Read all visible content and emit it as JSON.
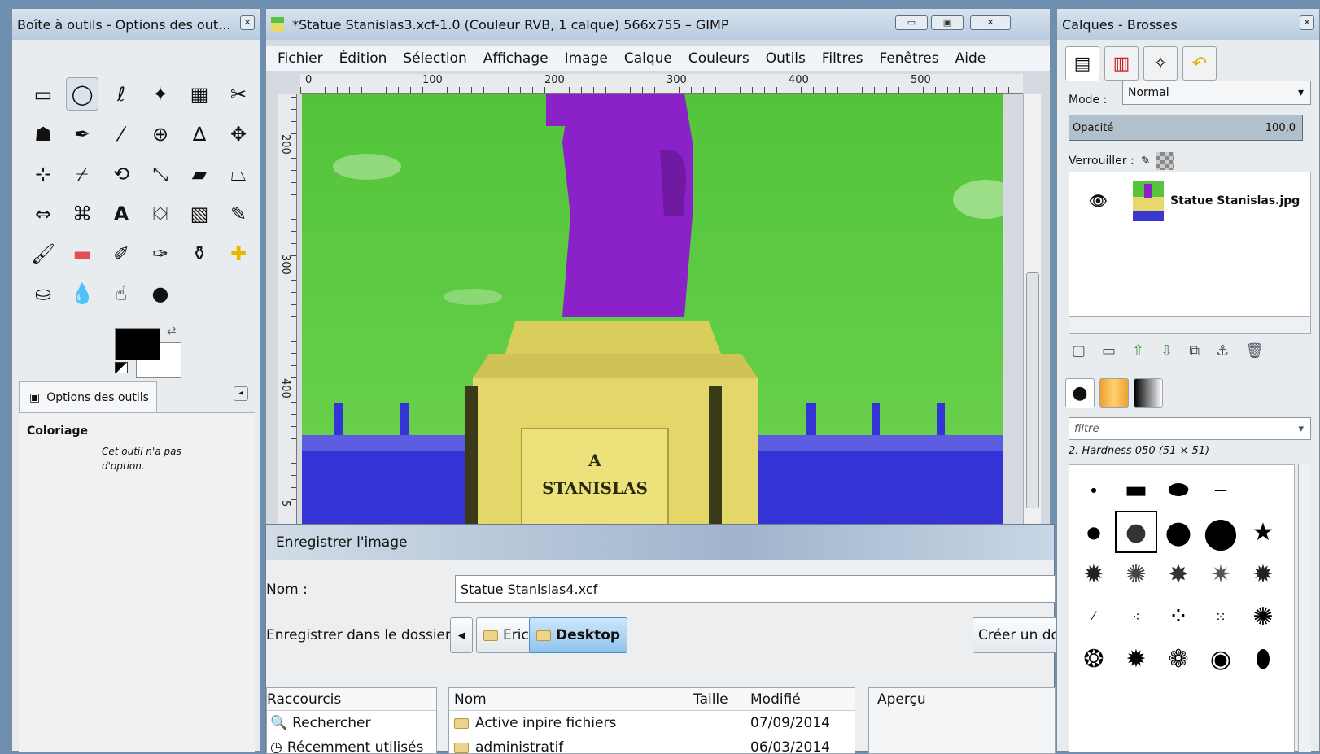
{
  "toolbox": {
    "title": "Boîte à outils - Options des out...",
    "tools": [
      "rect-select",
      "ellipse-select",
      "free-select",
      "fuzzy-select",
      "color-select",
      "scissors",
      "foreground-select",
      "paths",
      "color-picker",
      "zoom",
      "measure",
      "move",
      "align",
      "crop",
      "rotate",
      "scale",
      "shear",
      "perspective",
      "flip",
      "cage",
      "text",
      "bucket-fill",
      "blend",
      "pencil",
      "paintbrush",
      "eraser",
      "airbrush",
      "ink",
      "clone",
      "heal",
      "perspective-clone",
      "blur",
      "smudge",
      "dodge-burn"
    ],
    "options_tab": "Options des outils",
    "tool_name": "Coloriage",
    "tool_note": "Cet outil n'a pas d'option."
  },
  "image_window": {
    "title": "*Statue Stanislas3.xcf-1.0 (Couleur RVB, 1 calque) 566x755 – GIMP",
    "menu": [
      "Fichier",
      "Édition",
      "Sélection",
      "Affichage",
      "Image",
      "Calque",
      "Couleurs",
      "Outils",
      "Filtres",
      "Fenêtres",
      "Aide"
    ],
    "ruler_h": [
      "0",
      "100",
      "200",
      "300",
      "400",
      "500"
    ],
    "ruler_v": [
      "200",
      "300",
      "400",
      "5"
    ],
    "plaque_line1": "A",
    "plaque_line2": "STANISLAS",
    "colors": {
      "sky": "#5cc843",
      "statue": "#8b21c8",
      "pedestal": "#e3d76a",
      "buildings": "#3434d6"
    }
  },
  "save_dialog": {
    "title": "Enregistrer l'image",
    "name_label": "Nom :",
    "name_value": "Statue Stanislas4.xcf",
    "folder_label": "Enregistrer dans le dossier :",
    "path": [
      "Eric",
      "Desktop"
    ],
    "create_folder": "Créer un do",
    "places_header": "Raccourcis",
    "places": [
      "Rechercher",
      "Récemment utilisés"
    ],
    "files_headers": [
      "Nom",
      "Taille",
      "Modifié"
    ],
    "files": [
      {
        "name": "Active inpire fichiers",
        "size": "",
        "modified": "07/09/2014"
      },
      {
        "name": "administratif",
        "size": "",
        "modified": "06/03/2014"
      }
    ],
    "preview_label": "Aperçu"
  },
  "dock": {
    "title": "Calques - Brosses",
    "mode_label": "Mode :",
    "mode_value": "Normal",
    "opacity_label": "Opacité",
    "opacity_value": "100,0",
    "lock_label": "Verrouiller :",
    "layer_name": "Statue Stanislas.jpg",
    "filter_placeholder": "filtre",
    "brush_name": "2. Hardness 050 (51 × 51)"
  }
}
